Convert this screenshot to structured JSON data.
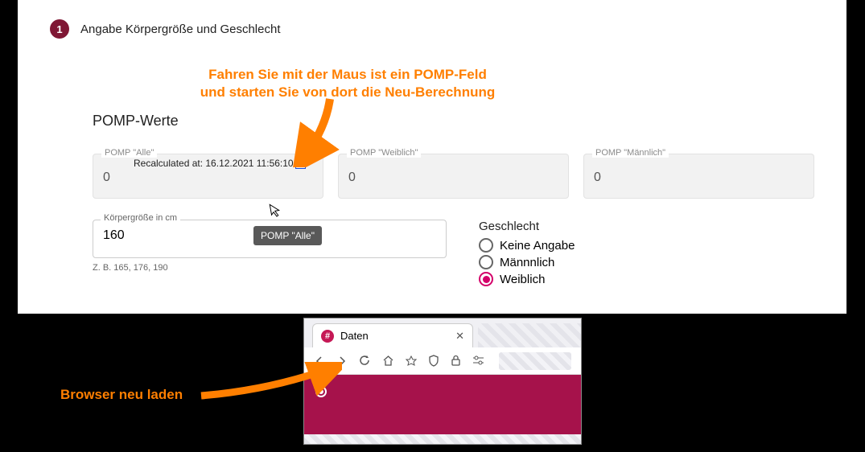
{
  "step": {
    "number": "1",
    "title": "Angabe Körpergröße und Geschlecht"
  },
  "annotation_top_line1": "Fahren Sie mit der Maus ist ein POMP-Feld",
  "annotation_top_line2": "und starten Sie von dort die Neu-Berechnung",
  "pomp": {
    "section_title": "POMP-Werte",
    "fields": [
      {
        "label": "POMP \"Alle\"",
        "value": "0",
        "recalc": "Recalculated at: 16.12.2021 11:56:10"
      },
      {
        "label": "POMP \"Weiblich\"",
        "value": "0"
      },
      {
        "label": "POMP \"Männlich\"",
        "value": "0"
      }
    ]
  },
  "height": {
    "label": "Körpergröße in cm",
    "value": "160",
    "hint": "Z. B. 165, 176, 190",
    "tooltip": "POMP \"Alle\""
  },
  "gender": {
    "title": "Geschlecht",
    "options": [
      "Keine Angabe",
      "Männnlich",
      "Weiblich"
    ],
    "selected": 2
  },
  "browser": {
    "tab_title": "Daten"
  },
  "annotation_bottom": "Browser neu laden"
}
